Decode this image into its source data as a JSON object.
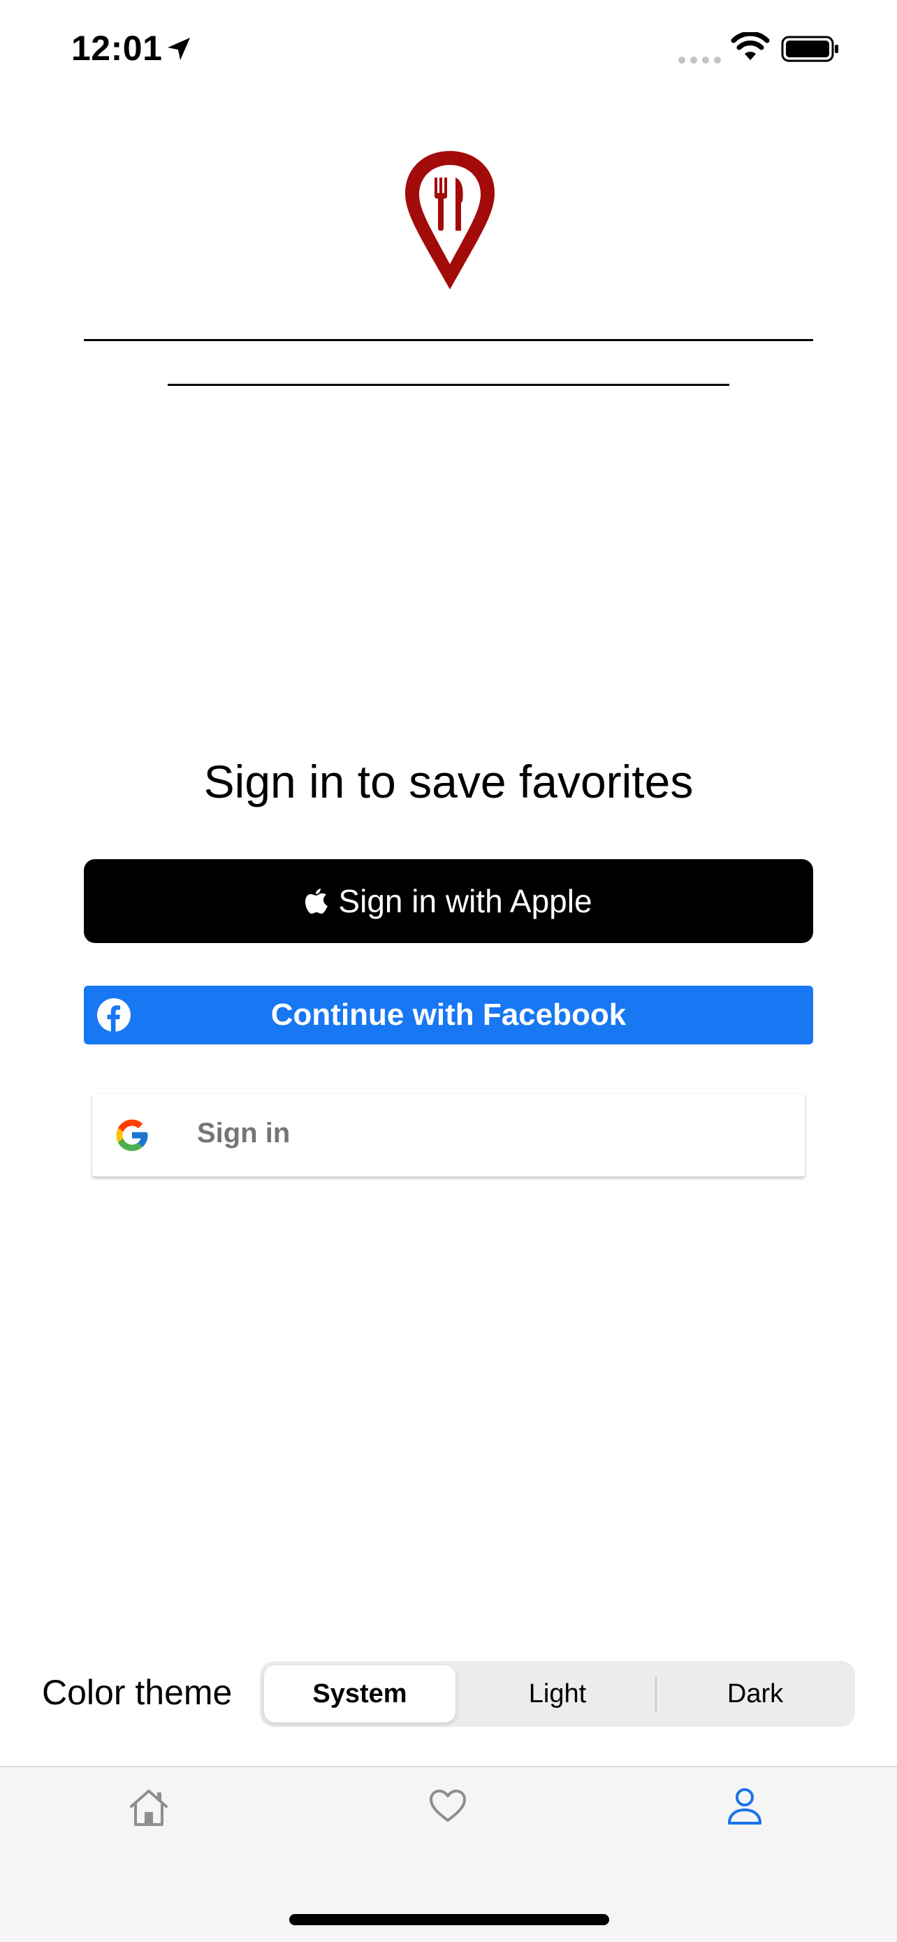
{
  "status_bar": {
    "time": "12:01"
  },
  "main": {
    "heading": "Sign in to save favorites",
    "apple_button_label": "Sign in with Apple",
    "facebook_button_label": "Continue with Facebook",
    "google_button_label": "Sign in"
  },
  "theme": {
    "label": "Color theme",
    "options": [
      "System",
      "Light",
      "Dark"
    ],
    "selected": "System"
  },
  "tab_bar": {
    "tabs": [
      {
        "icon": "home-icon",
        "active": false
      },
      {
        "icon": "heart-icon",
        "active": false
      },
      {
        "icon": "person-icon",
        "active": true
      }
    ]
  },
  "colors": {
    "logo": "#A30A0A",
    "facebook": "#1877F2",
    "active_tab": "#1A73E8",
    "inactive_tab": "#8E8E8E"
  }
}
